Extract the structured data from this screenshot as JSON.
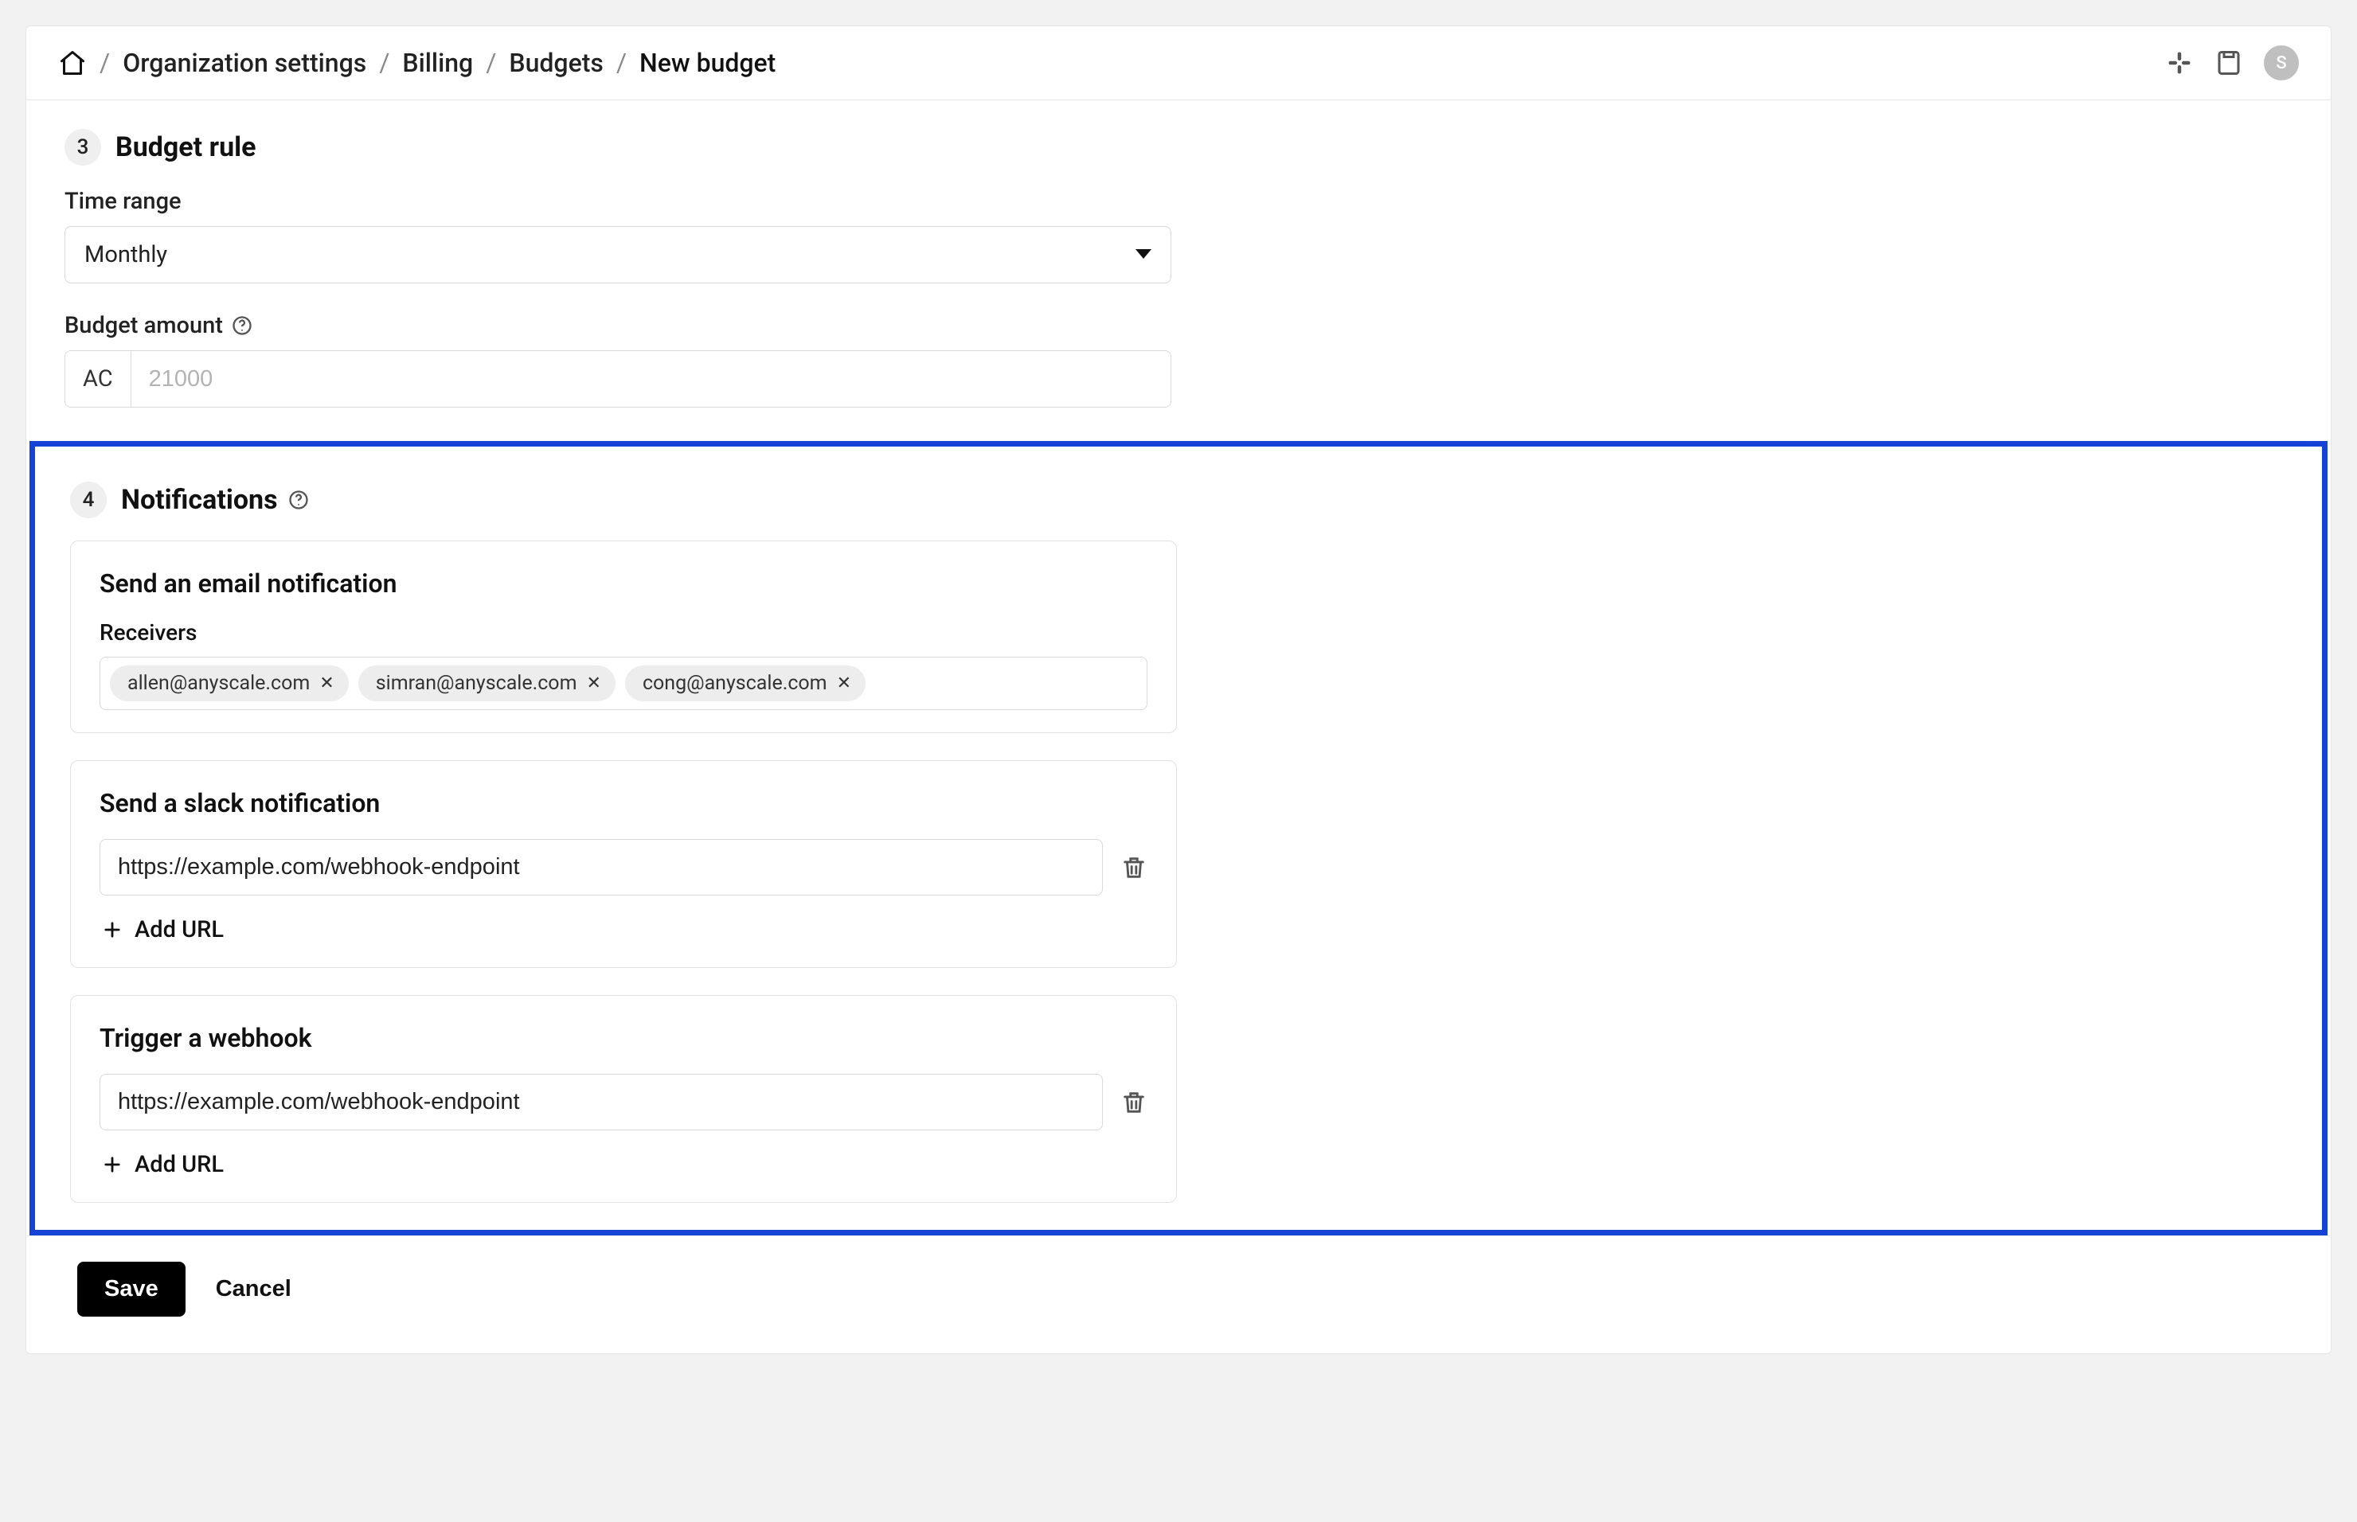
{
  "header": {
    "breadcrumbs": [
      "Organization settings",
      "Billing",
      "Budgets",
      "New budget"
    ],
    "avatar_initial": "S"
  },
  "step3": {
    "num": "3",
    "title": "Budget rule",
    "time_range_label": "Time range",
    "time_range_value": "Monthly",
    "budget_amount_label": "Budget amount",
    "currency_prefix": "AC",
    "budget_amount_placeholder": "21000"
  },
  "step4": {
    "num": "4",
    "title": "Notifications",
    "email_card": {
      "title": "Send an email notification",
      "receivers_label": "Receivers",
      "chips": [
        "allen@anyscale.com",
        "simran@anyscale.com",
        "cong@anyscale.com"
      ]
    },
    "slack_card": {
      "title": "Send a slack notification",
      "url_value": "https://example.com/webhook-endpoint",
      "add_label": "Add URL"
    },
    "webhook_card": {
      "title": "Trigger a webhook",
      "url_value": "https://example.com/webhook-endpoint",
      "add_label": "Add URL"
    }
  },
  "footer": {
    "save": "Save",
    "cancel": "Cancel"
  }
}
